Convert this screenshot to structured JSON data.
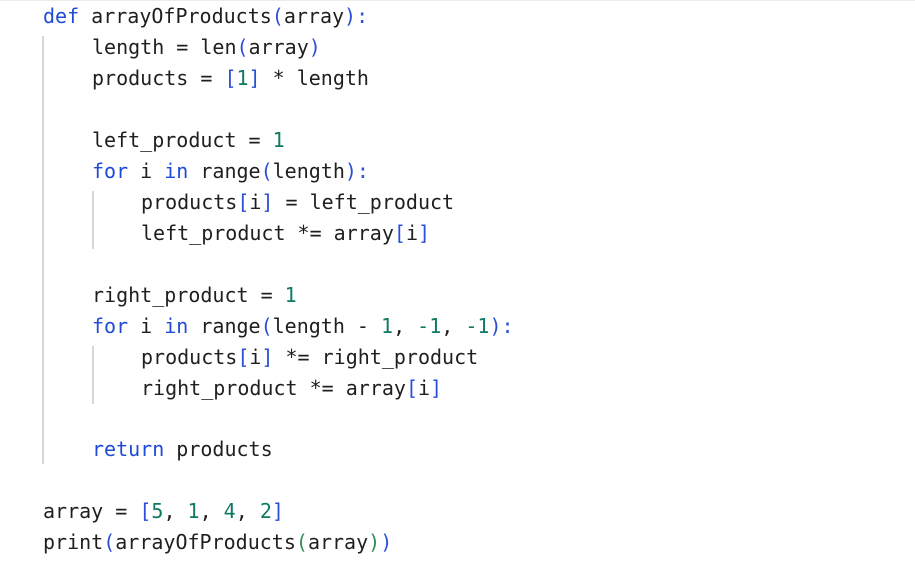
{
  "code_lines": [
    {
      "indent": 0,
      "tokens": [
        {
          "t": "def",
          "c": "kw"
        },
        {
          "t": " arrayOfProducts",
          "c": "fn"
        },
        {
          "t": "(",
          "c": "br1"
        },
        {
          "t": "array",
          "c": "fn"
        },
        {
          "t": "):",
          "c": "br1"
        }
      ]
    },
    {
      "indent": 1,
      "tokens": [
        {
          "t": "length",
          "c": "fn"
        },
        {
          "t": " = ",
          "c": "op"
        },
        {
          "t": "len",
          "c": "fn"
        },
        {
          "t": "(",
          "c": "br1"
        },
        {
          "t": "array",
          "c": "fn"
        },
        {
          "t": ")",
          "c": "br1"
        }
      ]
    },
    {
      "indent": 1,
      "tokens": [
        {
          "t": "products",
          "c": "fn"
        },
        {
          "t": " = ",
          "c": "op"
        },
        {
          "t": "[",
          "c": "br1"
        },
        {
          "t": "1",
          "c": "num"
        },
        {
          "t": "]",
          "c": "br1"
        },
        {
          "t": " * length",
          "c": "op"
        }
      ]
    },
    {
      "indent": 1,
      "tokens": []
    },
    {
      "indent": 1,
      "tokens": [
        {
          "t": "left_product",
          "c": "fn"
        },
        {
          "t": " = ",
          "c": "op"
        },
        {
          "t": "1",
          "c": "num"
        }
      ]
    },
    {
      "indent": 1,
      "tokens": [
        {
          "t": "for",
          "c": "kw"
        },
        {
          "t": " i ",
          "c": "fn"
        },
        {
          "t": "in",
          "c": "kw"
        },
        {
          "t": " range",
          "c": "fn"
        },
        {
          "t": "(",
          "c": "br1"
        },
        {
          "t": "length",
          "c": "fn"
        },
        {
          "t": "):",
          "c": "br1"
        }
      ]
    },
    {
      "indent": 2,
      "tokens": [
        {
          "t": "products",
          "c": "fn"
        },
        {
          "t": "[",
          "c": "br1"
        },
        {
          "t": "i",
          "c": "fn"
        },
        {
          "t": "]",
          "c": "br1"
        },
        {
          "t": " = left_product",
          "c": "op"
        }
      ]
    },
    {
      "indent": 2,
      "tokens": [
        {
          "t": "left_product",
          "c": "fn"
        },
        {
          "t": " *= ",
          "c": "op"
        },
        {
          "t": "array",
          "c": "fn"
        },
        {
          "t": "[",
          "c": "br1"
        },
        {
          "t": "i",
          "c": "fn"
        },
        {
          "t": "]",
          "c": "br1"
        }
      ]
    },
    {
      "indent": 1,
      "tokens": []
    },
    {
      "indent": 1,
      "tokens": [
        {
          "t": "right_product",
          "c": "fn"
        },
        {
          "t": " = ",
          "c": "op"
        },
        {
          "t": "1",
          "c": "num"
        }
      ]
    },
    {
      "indent": 1,
      "tokens": [
        {
          "t": "for",
          "c": "kw"
        },
        {
          "t": " i ",
          "c": "fn"
        },
        {
          "t": "in",
          "c": "kw"
        },
        {
          "t": " range",
          "c": "fn"
        },
        {
          "t": "(",
          "c": "br1"
        },
        {
          "t": "length - ",
          "c": "fn"
        },
        {
          "t": "1",
          "c": "num"
        },
        {
          "t": ", ",
          "c": "op"
        },
        {
          "t": "-1",
          "c": "num"
        },
        {
          "t": ", ",
          "c": "op"
        },
        {
          "t": "-1",
          "c": "num"
        },
        {
          "t": "):",
          "c": "br1"
        }
      ]
    },
    {
      "indent": 2,
      "tokens": [
        {
          "t": "products",
          "c": "fn"
        },
        {
          "t": "[",
          "c": "br1"
        },
        {
          "t": "i",
          "c": "fn"
        },
        {
          "t": "]",
          "c": "br1"
        },
        {
          "t": " *= right_product",
          "c": "op"
        }
      ]
    },
    {
      "indent": 2,
      "tokens": [
        {
          "t": "right_product",
          "c": "fn"
        },
        {
          "t": " *= ",
          "c": "op"
        },
        {
          "t": "array",
          "c": "fn"
        },
        {
          "t": "[",
          "c": "br1"
        },
        {
          "t": "i",
          "c": "fn"
        },
        {
          "t": "]",
          "c": "br1"
        }
      ]
    },
    {
      "indent": 1,
      "tokens": []
    },
    {
      "indent": 1,
      "tokens": [
        {
          "t": "return",
          "c": "kw"
        },
        {
          "t": " products",
          "c": "fn"
        }
      ]
    },
    {
      "indent": 0,
      "tokens": []
    },
    {
      "indent": 0,
      "tokens": [
        {
          "t": "array",
          "c": "fn"
        },
        {
          "t": " = ",
          "c": "op"
        },
        {
          "t": "[",
          "c": "br1"
        },
        {
          "t": "5",
          "c": "num"
        },
        {
          "t": ", ",
          "c": "op"
        },
        {
          "t": "1",
          "c": "num"
        },
        {
          "t": ", ",
          "c": "op"
        },
        {
          "t": "4",
          "c": "num"
        },
        {
          "t": ", ",
          "c": "op"
        },
        {
          "t": "2",
          "c": "num"
        },
        {
          "t": "]",
          "c": "br1"
        }
      ]
    },
    {
      "indent": 0,
      "tokens": [
        {
          "t": "print",
          "c": "fn"
        },
        {
          "t": "(",
          "c": "br1"
        },
        {
          "t": "arrayOfProducts",
          "c": "fn"
        },
        {
          "t": "(",
          "c": "br2"
        },
        {
          "t": "array",
          "c": "fn"
        },
        {
          "t": ")",
          "c": "br2"
        },
        {
          "t": ")",
          "c": "br1"
        }
      ]
    }
  ],
  "colors": {
    "keyword": "#1f4bd8",
    "number": "#0f7a62",
    "bracket_primary": "#2b4fd6",
    "bracket_secondary": "#2f8f4f",
    "text": "#1f1f1f",
    "indent_guide": "#d7d7d7"
  }
}
